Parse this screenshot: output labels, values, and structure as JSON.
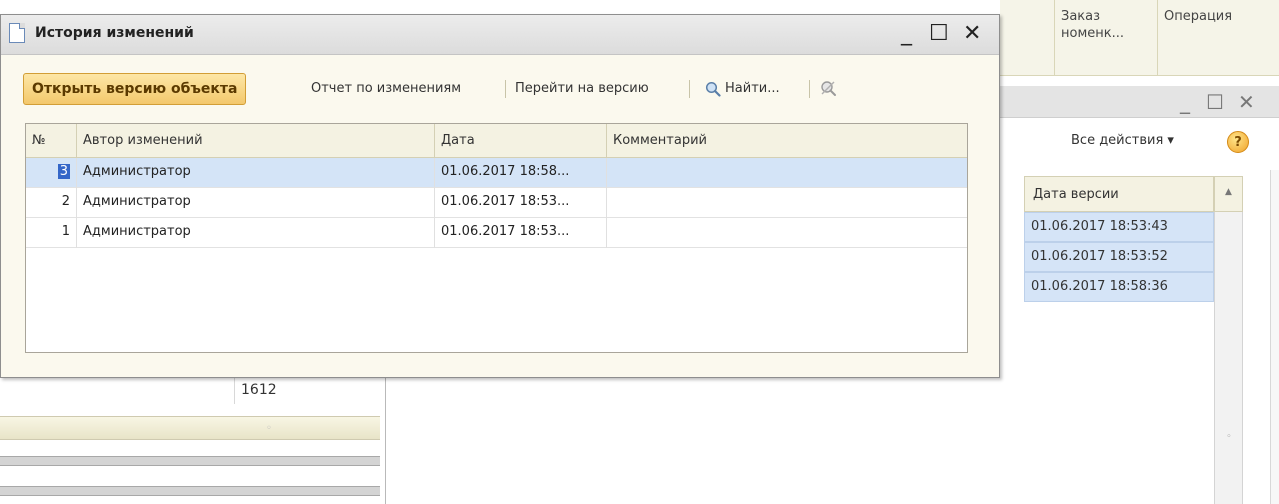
{
  "background": {
    "top_columns": [
      {
        "label": "Заказ\nноменк..."
      },
      {
        "label": "Операция"
      }
    ],
    "second_window": {
      "all_actions_label": "Все действия ▾",
      "help_label": "?",
      "version_column_header": "Дата версии",
      "version_rows": [
        "01.06.2017 18:53:43",
        "01.06.2017 18:53:52",
        "01.06.2017 18:58:36"
      ]
    },
    "bottom_left_value": "1612"
  },
  "dialog": {
    "title": "История изменений",
    "controls": {
      "minimize": "_",
      "maximize": "☐",
      "close": "✕"
    },
    "toolbar": {
      "open_version": "Открыть версию объекта",
      "report_changes": "Отчет по изменениям",
      "goto_version": "Перейти на версию",
      "find": "Найти..."
    },
    "grid": {
      "columns": [
        "№",
        "Автор изменений",
        "Дата",
        "Комментарий"
      ],
      "rows": [
        {
          "num": "3",
          "author": "Администратор",
          "date": "01.06.2017 18:58...",
          "comment": ""
        },
        {
          "num": "2",
          "author": "Администратор",
          "date": "01.06.2017 18:53...",
          "comment": ""
        },
        {
          "num": "1",
          "author": "Администратор",
          "date": "01.06.2017 18:53...",
          "comment": ""
        }
      ],
      "selected_row_index": 0
    }
  },
  "colors": {
    "accent_button": "#f3c86c",
    "selection": "#d4e4f7",
    "selected_number": "#3466c8"
  }
}
